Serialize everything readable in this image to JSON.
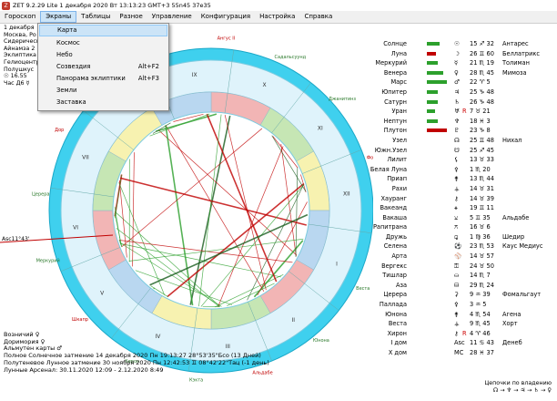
{
  "window": {
    "title": "ZET 9.2.29 Lite   1 декабря 2020 Вт 13:13:23 GMT+3 55n45  37e35"
  },
  "menu": {
    "items": [
      "Гороскоп",
      "Экраны",
      "Таблицы",
      "Разное",
      "Управление",
      "Конфигурация",
      "Настройка",
      "Справка"
    ]
  },
  "dropdown": {
    "items": [
      {
        "label": "Карта",
        "shortcut": ""
      },
      {
        "label": "Космос",
        "shortcut": ""
      },
      {
        "label": "Небо",
        "shortcut": ""
      },
      {
        "label": "Созвездия",
        "shortcut": "Alt+F2"
      },
      {
        "label": "Панорама эклиптики",
        "shortcut": "Alt+F3"
      },
      {
        "label": "Земли",
        "shortcut": ""
      },
      {
        "label": "Заставка",
        "shortcut": ""
      }
    ]
  },
  "left_info": [
    "1 декабря",
    "Москва, Ро",
    "",
    "Сидерическ",
    "Айнамза 2",
    "Эклиптика",
    "Гелиоцентр",
    "Полушкус",
    "☉ 16.55",
    "Час Д6 ☿"
  ],
  "planets": [
    {
      "name": "Солнце",
      "glyph": "☉",
      "rx": "",
      "pos": "15 ♐ 32",
      "star": "Антарес",
      "bar": "#2ca02c",
      "bw": 14
    },
    {
      "name": "Луна",
      "glyph": "☽",
      "rx": "",
      "pos": "26 ♊ 60",
      "star": "Беллатрикс",
      "bar": "#c00000",
      "bw": 10
    },
    {
      "name": "Меркурий",
      "glyph": "☿",
      "rx": "",
      "pos": "21 ♏ 19",
      "star": "Толиман",
      "bar": "#2ca02c",
      "bw": 12
    },
    {
      "name": "Венера",
      "glyph": "♀",
      "rx": "",
      "pos": "28 ♏ 45",
      "star": "Мимоза",
      "bar": "#2ca02c",
      "bw": 18
    },
    {
      "name": "Марс",
      "glyph": "♂",
      "rx": "",
      "pos": "22 ♈ 5",
      "star": "",
      "bar": "#2ca02c",
      "bw": 22
    },
    {
      "name": "Юпитер",
      "glyph": "♃",
      "rx": "",
      "pos": "25 ♑ 48",
      "star": "",
      "bar": "#2ca02c",
      "bw": 12
    },
    {
      "name": "Сатурн",
      "glyph": "♄",
      "rx": "",
      "pos": "26 ♑ 48",
      "star": "",
      "bar": "#2ca02c",
      "bw": 12
    },
    {
      "name": "Уран",
      "glyph": "♅",
      "rx": "R",
      "pos": "7 ♉ 21",
      "star": "",
      "bar": "#2ca02c",
      "bw": 9
    },
    {
      "name": "Нептун",
      "glyph": "♆",
      "rx": "",
      "pos": "18 ♓ 3",
      "star": "",
      "bar": "#2ca02c",
      "bw": 12
    },
    {
      "name": "Плутон",
      "glyph": "♇",
      "rx": "",
      "pos": "23 ♑ 8",
      "star": "",
      "bar": "#c00000",
      "bw": 22
    },
    {
      "name": "Узел",
      "glyph": "☊",
      "rx": "",
      "pos": "25 ♊ 48",
      "star": "Нихал",
      "bar": "",
      "bw": 0
    },
    {
      "name": "Южн.Узел",
      "glyph": "☋",
      "rx": "",
      "pos": "25 ♐ 45",
      "star": "",
      "bar": "",
      "bw": 0
    },
    {
      "name": "Лилит",
      "glyph": "⚸",
      "rx": "",
      "pos": "13 ♉ 33",
      "star": "",
      "bar": "",
      "bw": 0
    },
    {
      "name": "Белая Луна",
      "glyph": "⚴",
      "rx": "",
      "pos": "1 ♏ 20",
      "star": "",
      "bar": "",
      "bw": 0
    },
    {
      "name": "Приап",
      "glyph": "⚵",
      "rx": "",
      "pos": "13 ♏ 44",
      "star": "",
      "bar": "",
      "bw": 0
    },
    {
      "name": "Рахи",
      "glyph": "⚶",
      "rx": "",
      "pos": "14 ♉ 31",
      "star": "",
      "bar": "",
      "bw": 0
    },
    {
      "name": "Хауранг",
      "glyph": "⚷",
      "rx": "",
      "pos": "14 ♉ 39",
      "star": "",
      "bar": "",
      "bw": 0
    },
    {
      "name": "Вакеанд",
      "glyph": "⚹",
      "rx": "",
      "pos": "19 ♊ 11",
      "star": "",
      "bar": "",
      "bw": 0
    },
    {
      "name": "Вакаша",
      "glyph": "⚺",
      "rx": "",
      "pos": "5 ♊ 35",
      "star": "Альдабе",
      "bar": "",
      "bw": 0
    },
    {
      "name": "Рапитрана",
      "glyph": "⚻",
      "rx": "",
      "pos": "16 ♉ 6",
      "star": "",
      "bar": "",
      "bw": 0
    },
    {
      "name": "Дружь",
      "glyph": "⚼",
      "rx": "",
      "pos": "1 ♍ 36",
      "star": "Шедир",
      "bar": "",
      "bw": 0
    },
    {
      "name": "Селена",
      "glyph": "⚽",
      "rx": "",
      "pos": "23 ♏ 53",
      "star": "Каус Медиус",
      "bar": "",
      "bw": 0
    },
    {
      "name": "Арта",
      "glyph": "⚾",
      "rx": "",
      "pos": "14 ♉ 57",
      "star": "",
      "bar": "",
      "bw": 0
    },
    {
      "name": "Вергекс",
      "glyph": "⚿",
      "rx": "",
      "pos": "24 ♉ 50",
      "star": "",
      "bar": "",
      "bw": 0
    },
    {
      "name": "Тишлар",
      "glyph": "⛀",
      "rx": "",
      "pos": "14 ♏ 7",
      "star": "",
      "bar": "",
      "bw": 0
    },
    {
      "name": "Аза",
      "glyph": "⛁",
      "rx": "",
      "pos": "29 ♏ 24",
      "star": "",
      "bar": "",
      "bw": 0
    },
    {
      "name": "Церера",
      "glyph": "⚳",
      "rx": "",
      "pos": "9 ♒ 39",
      "star": "Фомальгаут",
      "bar": "",
      "bw": 0
    },
    {
      "name": "Паллада",
      "glyph": "⚴",
      "rx": "",
      "pos": "3 ♒ 5",
      "star": "",
      "bar": "",
      "bw": 0
    },
    {
      "name": "Юнона",
      "glyph": "⚵",
      "rx": "",
      "pos": "4 ♏ 54",
      "star": "Агена",
      "bar": "",
      "bw": 0
    },
    {
      "name": "Веста",
      "glyph": "⚶",
      "rx": "",
      "pos": "9 ♏ 45",
      "star": "Хорт",
      "bar": "",
      "bw": 0
    },
    {
      "name": "Хирон",
      "glyph": "⚷",
      "rx": "R",
      "pos": "4 ♈ 46",
      "star": "",
      "bar": "",
      "bw": 0
    },
    {
      "name": "I дом",
      "glyph": "Asc",
      "rx": "",
      "pos": "11 ♋ 43",
      "star": "Денеб",
      "bar": "",
      "bw": 0
    },
    {
      "name": "X дом",
      "glyph": "MC",
      "rx": "",
      "pos": "28 ♓ 37",
      "star": "",
      "bar": "",
      "bw": 0
    }
  ],
  "bottom_info": [
    "Возничий ♀",
    "Доримория ♀",
    "Альмутен карты ♂",
    "Полное Солнечное затмение 14 декабря 2020 Пн 19:13:27 28°53'35\"Бсо (13 Дней)",
    "Полутеневое Лунное затмение 30 ноября 2020 Пн 12:42:53 ♊ 08°42'22\"Тац (-1 день)",
    "Лунные Арсенал: 30.11.2020 12:09 - 2.12.2020 8:49"
  ],
  "lots": {
    "title": "Цепочки по владению",
    "line": "☊ → ♆ → ♃ → ♄ → ♀"
  },
  "chart_labels": {
    "asc": "Asc11°43'",
    "houses": [
      "I",
      "II",
      "III",
      "IV",
      "V",
      "VI",
      "VII",
      "VIII",
      "IX",
      "X",
      "XI",
      "XII"
    ],
    "star_labels": [
      "Хорт",
      "Веста",
      "Юнона",
      "Альдабе",
      "Кэкта",
      "Хирон",
      "Шкапр",
      "Меркурий",
      "Церера",
      "Дор",
      "Дзб",
      "Земля",
      "Ангус II",
      "Садальсуунд",
      "Джанитинз",
      "Фонал"
    ]
  }
}
